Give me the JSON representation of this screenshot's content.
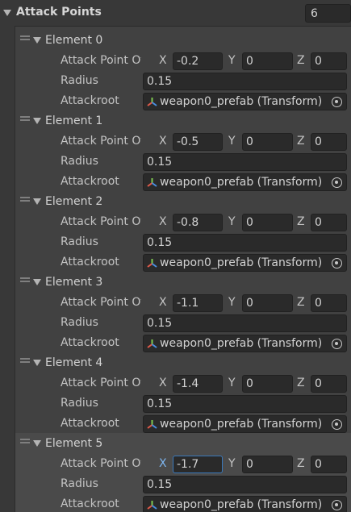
{
  "header": {
    "title": "Attack Points",
    "size": "6"
  },
  "labels": {
    "vector": "Attack Point Offset",
    "x": "X",
    "y": "Y",
    "z": "Z",
    "radius": "Radius",
    "root": "Attackroot"
  },
  "elements": [
    {
      "title": "Element 0",
      "x": "-0.2",
      "y": "0",
      "z": "0",
      "radius": "0.15",
      "root": "weapon0_prefab (Transform)"
    },
    {
      "title": "Element 1",
      "x": "-0.5",
      "y": "0",
      "z": "0",
      "radius": "0.15",
      "root": "weapon0_prefab (Transform)"
    },
    {
      "title": "Element 2",
      "x": "-0.8",
      "y": "0",
      "z": "0",
      "radius": "0.15",
      "root": "weapon0_prefab (Transform)"
    },
    {
      "title": "Element 3",
      "x": "-1.1",
      "y": "0",
      "z": "0",
      "radius": "0.15",
      "root": "weapon0_prefab (Transform)"
    },
    {
      "title": "Element 4",
      "x": "-1.4",
      "y": "0",
      "z": "0",
      "radius": "0.15",
      "root": "weapon0_prefab (Transform)"
    },
    {
      "title": "Element 5",
      "x": "-1.7",
      "y": "0",
      "z": "0",
      "radius": "0.15",
      "root": "weapon0_prefab (Transform)"
    }
  ],
  "selected_index": 5,
  "icons": {
    "fold": "foldout-triangle-icon",
    "drag": "drag-handle-icon",
    "transform": "transform-icon",
    "picker": "object-picker-icon"
  },
  "colors": {
    "background": "#383838",
    "field": "#2a2a2a",
    "focus_border": "#3a79bb",
    "x_axis_focus": "#7eb6f0"
  }
}
